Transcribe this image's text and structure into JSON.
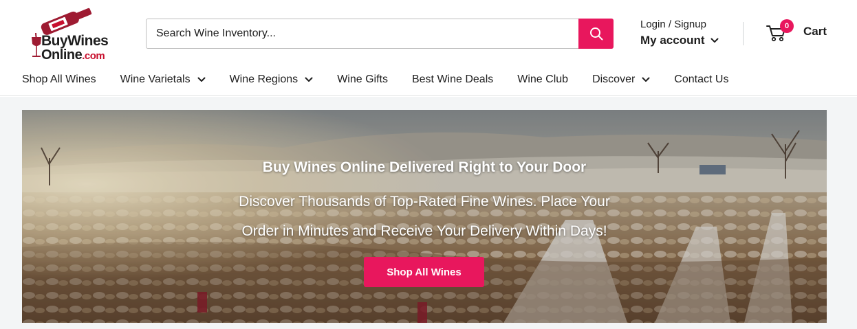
{
  "brand": {
    "logo_line1": "BuyWines",
    "logo_line2_main": "Online",
    "logo_line2_suffix": ".com",
    "brand_color": "#c8102e",
    "logo_icon": "wine-bottle-pouring-into-glass"
  },
  "search": {
    "placeholder": "Search Wine Inventory...",
    "value": "",
    "button_icon": "search-icon"
  },
  "account": {
    "login_label": "Login / Signup",
    "my_account_label": "My account",
    "dropdown_icon": "chevron-down-icon"
  },
  "cart": {
    "label": "Cart",
    "count": "0",
    "icon": "cart-icon"
  },
  "nav": {
    "items": [
      {
        "label": "Shop All Wines",
        "has_dropdown": false
      },
      {
        "label": "Wine Varietals",
        "has_dropdown": true
      },
      {
        "label": "Wine Regions",
        "has_dropdown": true
      },
      {
        "label": "Wine Gifts",
        "has_dropdown": false
      },
      {
        "label": "Best Wine Deals",
        "has_dropdown": false
      },
      {
        "label": "Wine Club",
        "has_dropdown": false
      },
      {
        "label": "Discover",
        "has_dropdown": true
      },
      {
        "label": "Contact Us",
        "has_dropdown": false
      }
    ]
  },
  "hero": {
    "title": "Buy Wines Online Delivered Right to Your Door",
    "subtitle_line1": "Discover Thousands of Top-Rated Fine Wines. Place Your",
    "subtitle_line2": "Order in Minutes and Receive Your Delivery Within Days!",
    "cta_label": "Shop All Wines",
    "background": "snowy-vineyard-sunset"
  },
  "colors": {
    "accent": "#e8175d",
    "text": "#1e1e1e",
    "page_background": "#f3f5f6"
  }
}
